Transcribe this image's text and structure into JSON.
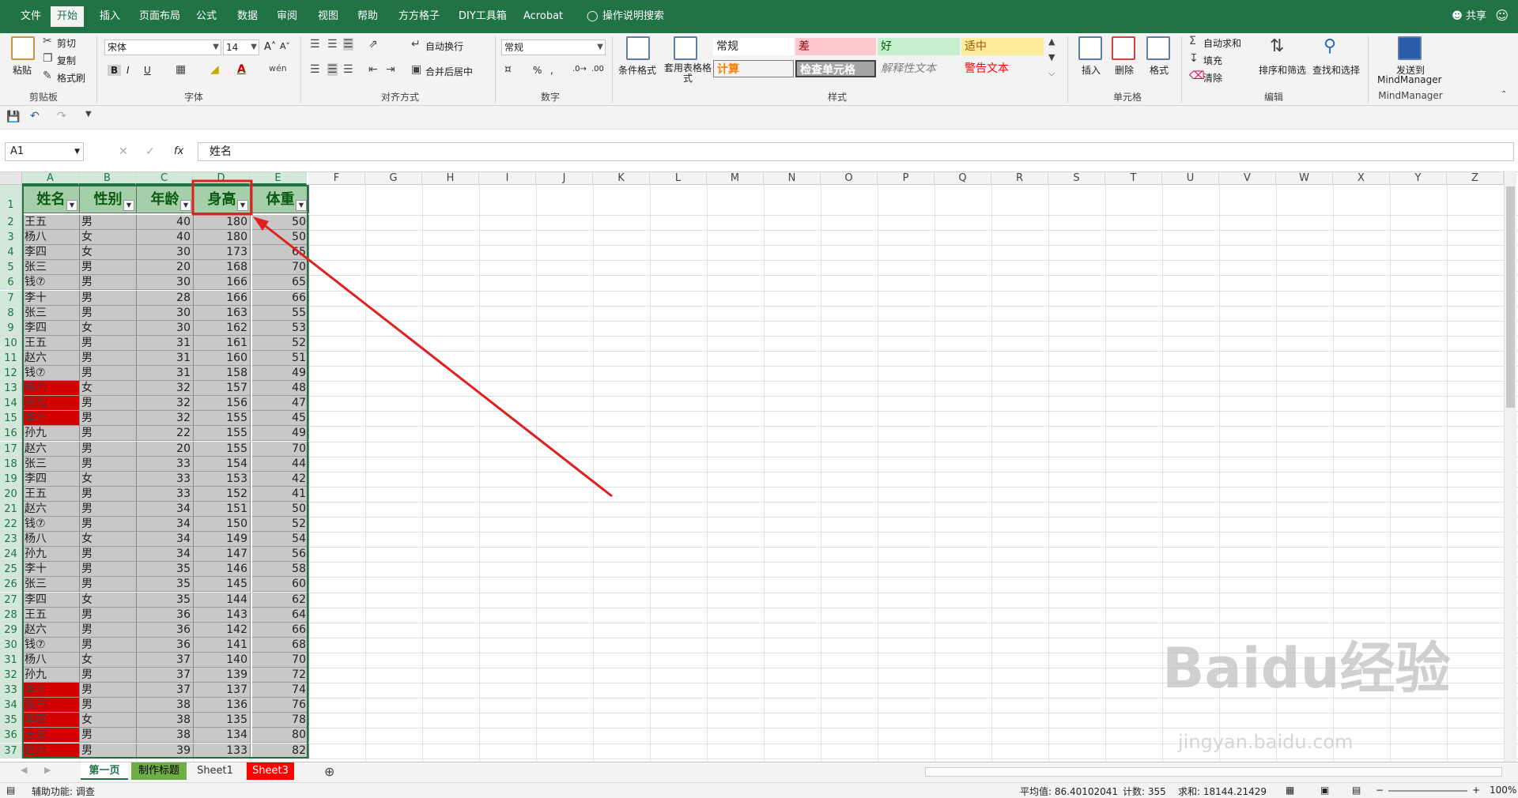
{
  "menu": {
    "file": "文件",
    "home": "开始",
    "insert": "插入",
    "layout": "页面布局",
    "formulas": "公式",
    "data": "数据",
    "review": "审阅",
    "view": "视图",
    "help": "帮助",
    "fangfang": "方方格子",
    "diy": "DIY工具箱",
    "acrobat": "Acrobat",
    "search": "操作说明搜索",
    "share": "共享"
  },
  "ribbon": {
    "clipboard": {
      "paste": "粘贴",
      "cut": "剪切",
      "copy": "复制",
      "painter": "格式刷",
      "label": "剪贴板"
    },
    "font": {
      "name": "宋体",
      "size": "14",
      "bold": "B",
      "italic": "I",
      "underline": "U",
      "label": "字体"
    },
    "align": {
      "wrap": "自动换行",
      "merge": "合并后居中",
      "label": "对齐方式"
    },
    "number": {
      "format": "常规",
      "percent": "%",
      "comma": ",",
      "label": "数字"
    },
    "styles": {
      "cond": "条件格式",
      "table": "套用表格格式",
      "normal": "常规",
      "bad": "差",
      "good": "好",
      "neutral": "适中",
      "calc": "计算",
      "check": "检查单元格",
      "explain": "解释性文本",
      "warn": "警告文本",
      "label": "样式"
    },
    "cells": {
      "insert": "插入",
      "delete": "删除",
      "format": "格式",
      "label": "单元格"
    },
    "edit": {
      "autosum": "自动求和",
      "fill": "填充",
      "clear": "清除",
      "sort": "排序和筛选",
      "find": "查找和选择",
      "label": "编辑"
    },
    "mind": {
      "send": "发送到",
      "app": "MindManager",
      "label": "MindManager"
    }
  },
  "namebox": "A1",
  "fx": "fx",
  "formula": "姓名",
  "columns": [
    "A",
    "B",
    "C",
    "D",
    "E",
    "F",
    "G",
    "H",
    "I",
    "J",
    "K",
    "L",
    "M",
    "N",
    "O",
    "P",
    "Q",
    "R",
    "S",
    "T",
    "U",
    "V",
    "W",
    "X",
    "Y",
    "Z"
  ],
  "headers": [
    "姓名",
    "性别",
    "年龄",
    "身高",
    "体重"
  ],
  "rows": [
    [
      "王五",
      "男",
      40,
      180,
      50
    ],
    [
      "杨八",
      "女",
      40,
      180,
      50
    ],
    [
      "李四",
      "女",
      30,
      173,
      65
    ],
    [
      "张三",
      "男",
      20,
      168,
      70
    ],
    [
      "钱⑦",
      "男",
      30,
      166,
      65
    ],
    [
      "李十",
      "男",
      28,
      166,
      66
    ],
    [
      "张三",
      "男",
      30,
      163,
      55
    ],
    [
      "李四",
      "女",
      30,
      162,
      53
    ],
    [
      "王五",
      "男",
      31,
      161,
      52
    ],
    [
      "赵六",
      "男",
      31,
      160,
      51
    ],
    [
      "钱⑦",
      "男",
      31,
      158,
      49
    ],
    [
      "杨八",
      "女",
      32,
      157,
      48
    ],
    [
      "孙九",
      "男",
      32,
      156,
      47
    ],
    [
      "李十",
      "男",
      32,
      155,
      45
    ],
    [
      "孙九",
      "男",
      22,
      155,
      49
    ],
    [
      "赵六",
      "男",
      20,
      155,
      70
    ],
    [
      "张三",
      "男",
      33,
      154,
      44
    ],
    [
      "李四",
      "女",
      33,
      153,
      42
    ],
    [
      "王五",
      "男",
      33,
      152,
      41
    ],
    [
      "赵六",
      "男",
      34,
      151,
      50
    ],
    [
      "钱⑦",
      "男",
      34,
      150,
      52
    ],
    [
      "杨八",
      "女",
      34,
      149,
      54
    ],
    [
      "孙九",
      "男",
      34,
      147,
      56
    ],
    [
      "李十",
      "男",
      35,
      146,
      58
    ],
    [
      "张三",
      "男",
      35,
      145,
      60
    ],
    [
      "李四",
      "女",
      35,
      144,
      62
    ],
    [
      "王五",
      "男",
      36,
      143,
      64
    ],
    [
      "赵六",
      "男",
      36,
      142,
      66
    ],
    [
      "钱⑦",
      "男",
      36,
      141,
      68
    ],
    [
      "杨八",
      "女",
      37,
      140,
      70
    ],
    [
      "孙九",
      "男",
      37,
      139,
      72
    ],
    [
      "李十",
      "男",
      37,
      137,
      74
    ],
    [
      "张三",
      "男",
      38,
      136,
      76
    ],
    [
      "李四",
      "女",
      38,
      135,
      78
    ],
    [
      "王五",
      "男",
      38,
      134,
      80
    ],
    [
      "赵六",
      "男",
      39,
      133,
      82
    ]
  ],
  "red_rows": [
    13,
    14,
    15,
    33,
    34,
    35,
    36,
    37
  ],
  "sheets": [
    "第一页",
    "制作标题",
    "Sheet1",
    "Sheet3"
  ],
  "status": {
    "access": "辅助功能: 调查",
    "avg": "平均值: 86.40102041",
    "count": "计数: 355",
    "sum": "求和: 18144.21429",
    "zoom": "100%"
  },
  "colors": {
    "excel_green": "#217346",
    "header_fill": "#a5cfa8",
    "red_fill": "#d40000",
    "annotation": "#e02020"
  },
  "watermark": {
    "brand": "Baidu经验",
    "url": "jingyan.baidu.com"
  }
}
